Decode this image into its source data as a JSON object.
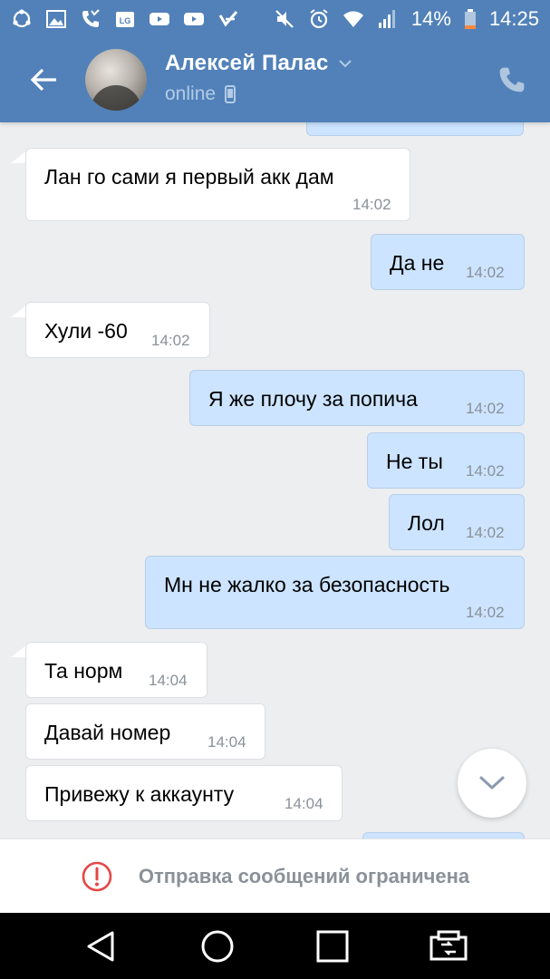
{
  "status_bar": {
    "battery_percent": "14%",
    "time": "14:25",
    "left_icons": [
      "sync-icon",
      "image-icon",
      "missed-call-icon",
      "lg-icon",
      "youtube-icon",
      "youtube-icon",
      "checkmark-app-icon"
    ],
    "right_icons": [
      "mute-icon",
      "alarm-icon",
      "wifi-icon",
      "signal-icon",
      "battery-low-icon"
    ]
  },
  "header": {
    "contact_name": "Алексей Палас",
    "status": "online",
    "colors": {
      "bar": "#5181b8",
      "status_text": "#b3cbe6"
    }
  },
  "messages": [
    {
      "direction": "out",
      "text": "",
      "time": "14:02",
      "partial": true
    },
    {
      "direction": "in",
      "text": "Лан го сами я первый акк дам",
      "time": "14:02"
    },
    {
      "direction": "out",
      "text": "Да не",
      "time": "14:02"
    },
    {
      "direction": "in",
      "text": "Хули -60",
      "time": "14:02"
    },
    {
      "direction": "out",
      "text": "Я же плочу за попича",
      "time": "14:02"
    },
    {
      "direction": "out",
      "text": "Не ты",
      "time": "14:02"
    },
    {
      "direction": "out",
      "text": "Лол",
      "time": "14:02"
    },
    {
      "direction": "out",
      "text": "Мн не жалко за безопасность",
      "time": "14:02"
    },
    {
      "direction": "in",
      "text": "Та норм",
      "time": "14:04"
    },
    {
      "direction": "in",
      "text": "Давай номер",
      "time": "14:04"
    },
    {
      "direction": "in",
      "text": "Привежу к аккаунту",
      "time": "14:04"
    },
    {
      "direction": "out",
      "text": "",
      "time": "",
      "partial": true
    }
  ],
  "bubble_colors": {
    "incoming": "#ffffff",
    "outgoing": "#cce4ff"
  },
  "restricted_notice": "Отправка сообщений ограничена",
  "nav_icons": [
    "back-triangle-icon",
    "home-circle-icon",
    "recents-square-icon",
    "dual-window-icon"
  ]
}
